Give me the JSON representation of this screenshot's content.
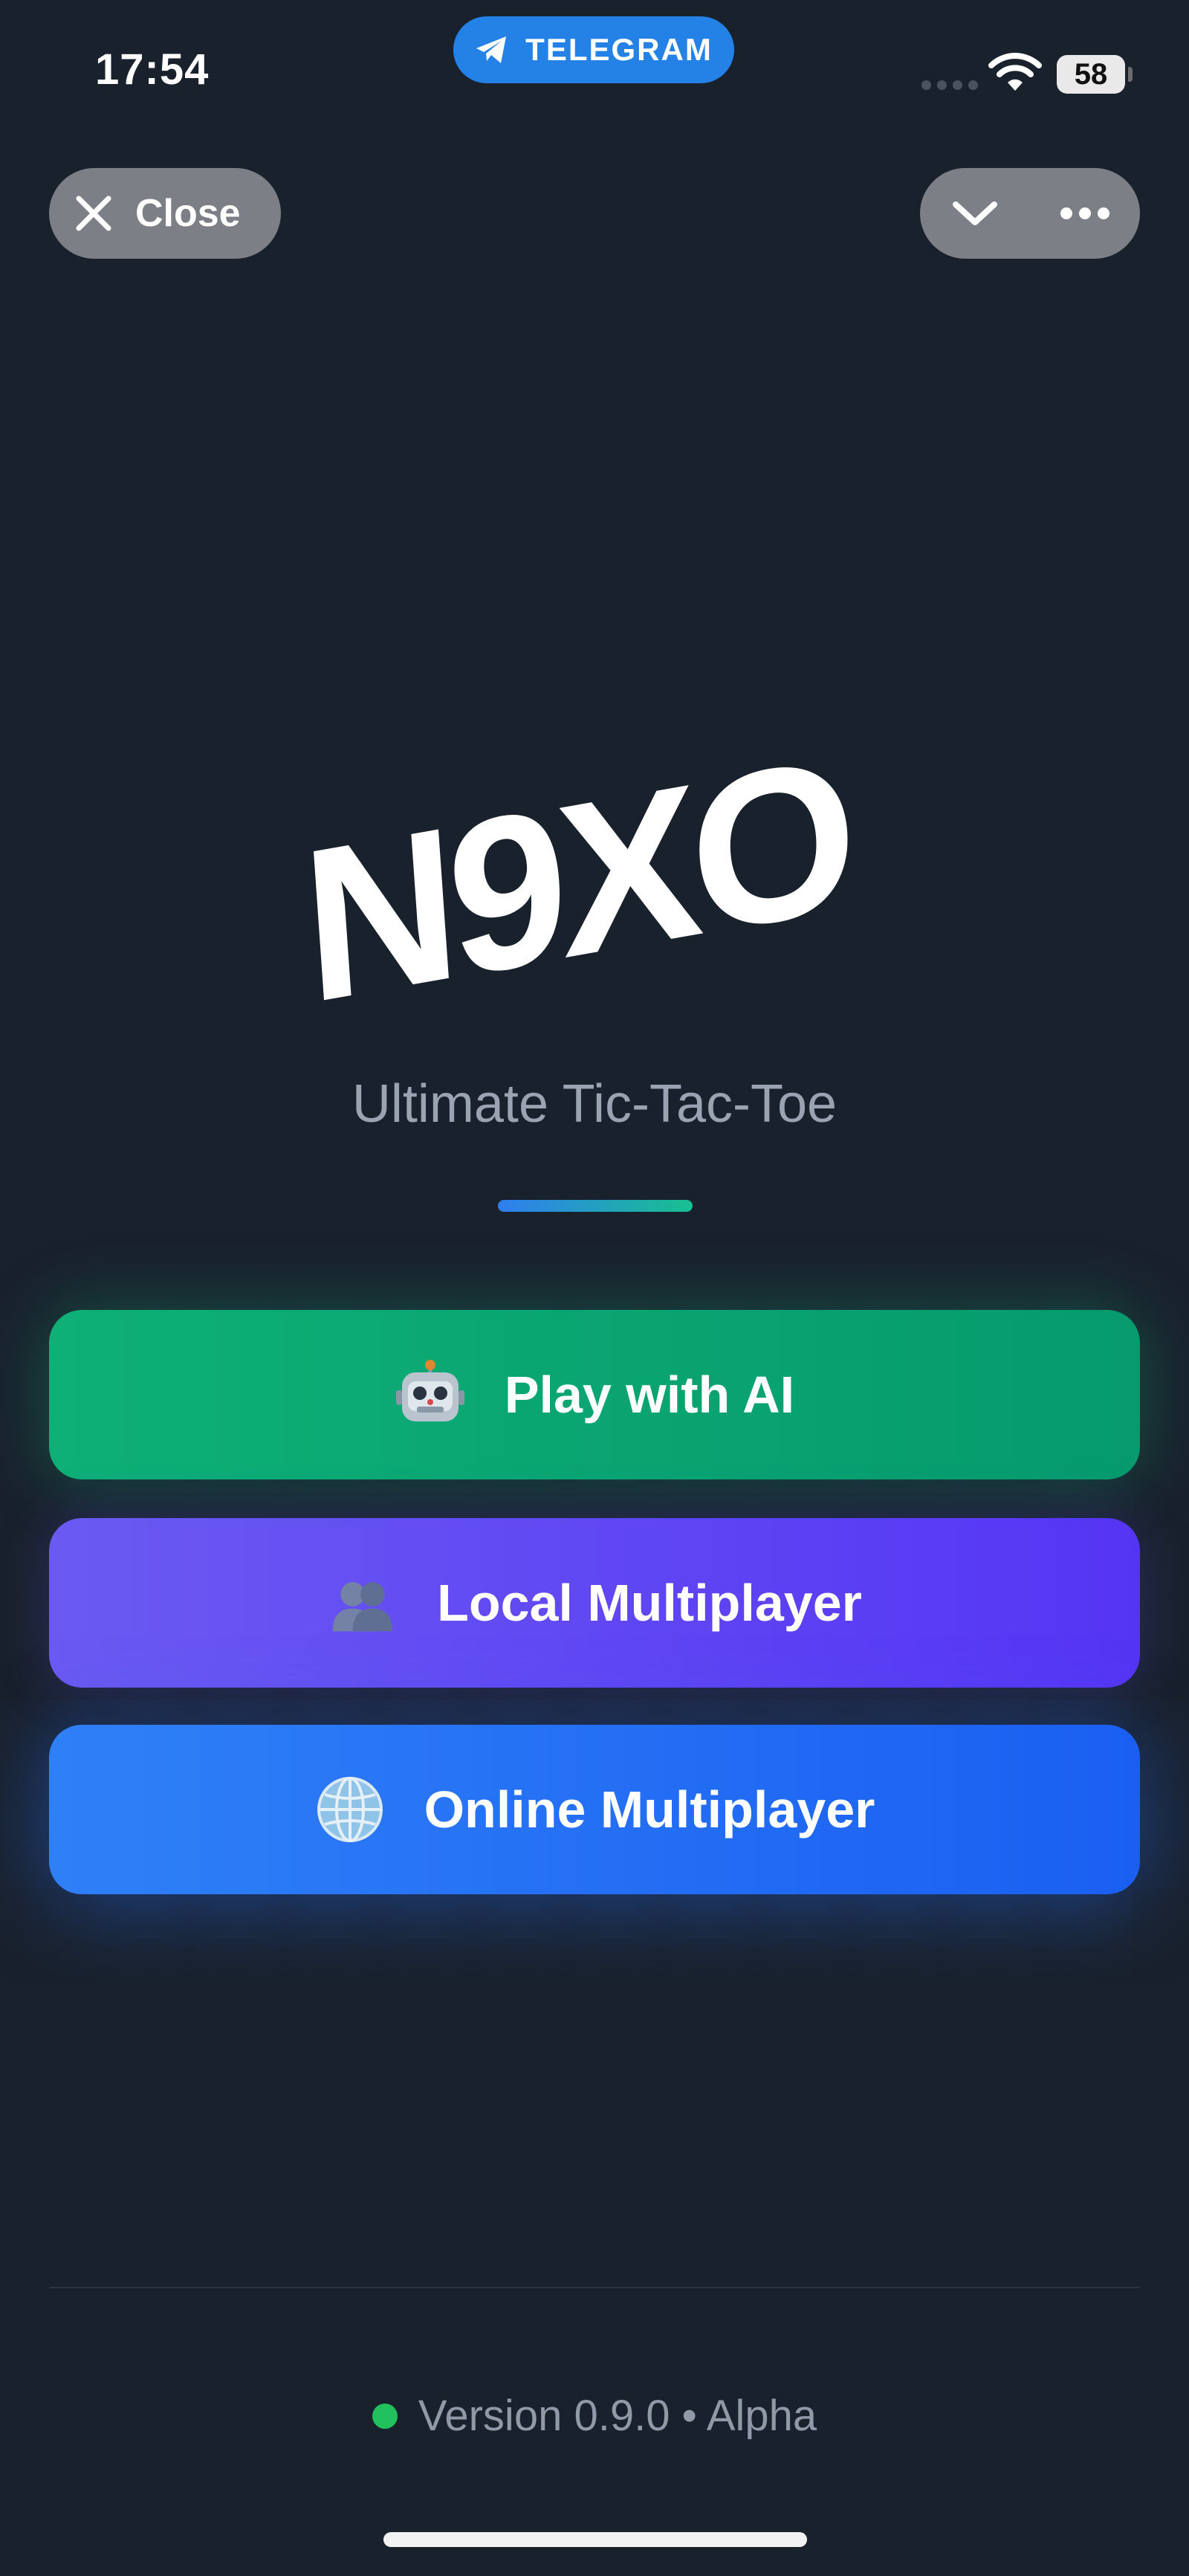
{
  "status_bar": {
    "time": "17:54",
    "app_pill_label": "TELEGRAM",
    "battery_level": "58"
  },
  "top_bar": {
    "close_label": "Close",
    "icons": [
      "close-icon",
      "chevron-down-icon",
      "more-icon"
    ]
  },
  "brand": {
    "logo_text": "N9XO",
    "subtitle": "Ultimate Tic-Tac-Toe"
  },
  "modes": [
    {
      "label": "Play with AI",
      "icon": "robot-icon",
      "color": "#10b981"
    },
    {
      "label": "Local Multiplayer",
      "icon": "people-icon",
      "color": "#5b45f3"
    },
    {
      "label": "Online Multiplayer",
      "icon": "globe-icon",
      "color": "#2563eb"
    }
  ],
  "footer": {
    "version_text": "Version 0.9.0 • Alpha",
    "status_color": "#22c55e"
  },
  "colors": {
    "background": "#19212c",
    "telegram_blue": "#2481e6",
    "pill_gray": "#7c7f85"
  }
}
